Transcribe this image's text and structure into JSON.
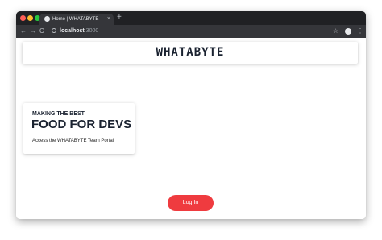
{
  "browser": {
    "tab_title": "Home | WHATABYTE",
    "tab_close": "×",
    "new_tab": "+",
    "back": "←",
    "forward": "→",
    "reload": "C",
    "url_host": "localhost",
    "url_port": ":3000",
    "star": "☆",
    "menu": "⋮"
  },
  "header": {
    "brand": "WHATABYTE"
  },
  "hero": {
    "eyebrow": "MAKING THE BEST",
    "headline": "FOOD FOR DEVS",
    "subtitle": "Access the WHATABYTE Team Portal"
  },
  "login": {
    "label": "Log In"
  },
  "colors": {
    "accent": "#ef3b3f",
    "text_dark": "#1a2230",
    "chrome_dark": "#202124"
  }
}
